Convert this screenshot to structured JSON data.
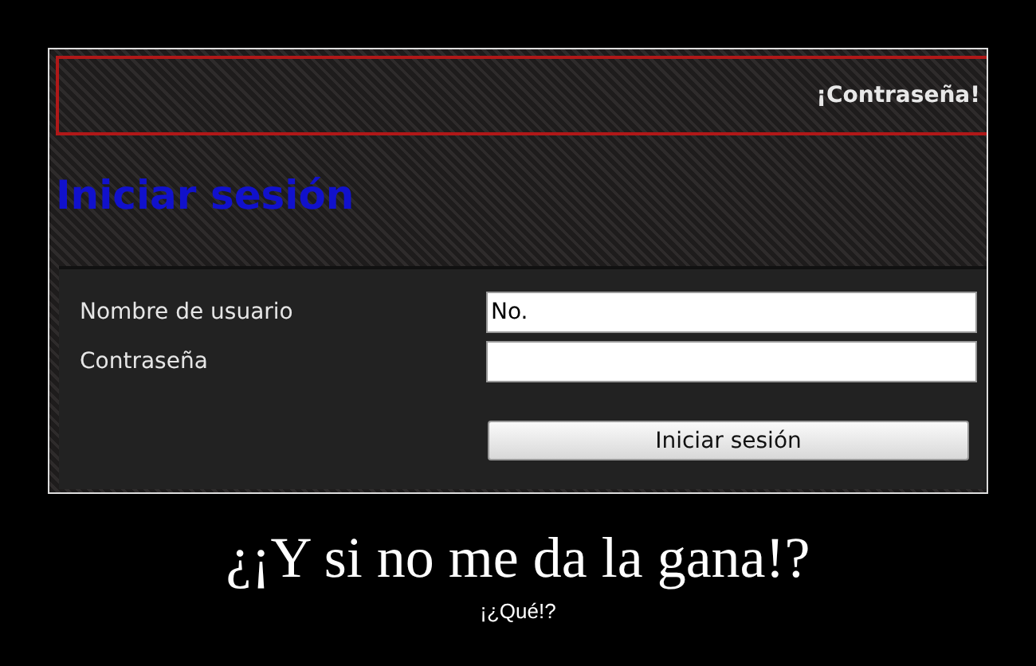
{
  "screenshot": {
    "banner": {
      "text": "¡Contraseña!"
    },
    "heading": "Iniciar sesión",
    "form": {
      "fields": [
        {
          "label": "Nombre de usuario",
          "value": "No."
        },
        {
          "label": "Contraseña"
        }
      ],
      "button": "Iniciar sesión"
    }
  },
  "caption": {
    "title": "¿¡Y si no me da la gana!?",
    "subtitle": "¡¿Qué!?"
  }
}
